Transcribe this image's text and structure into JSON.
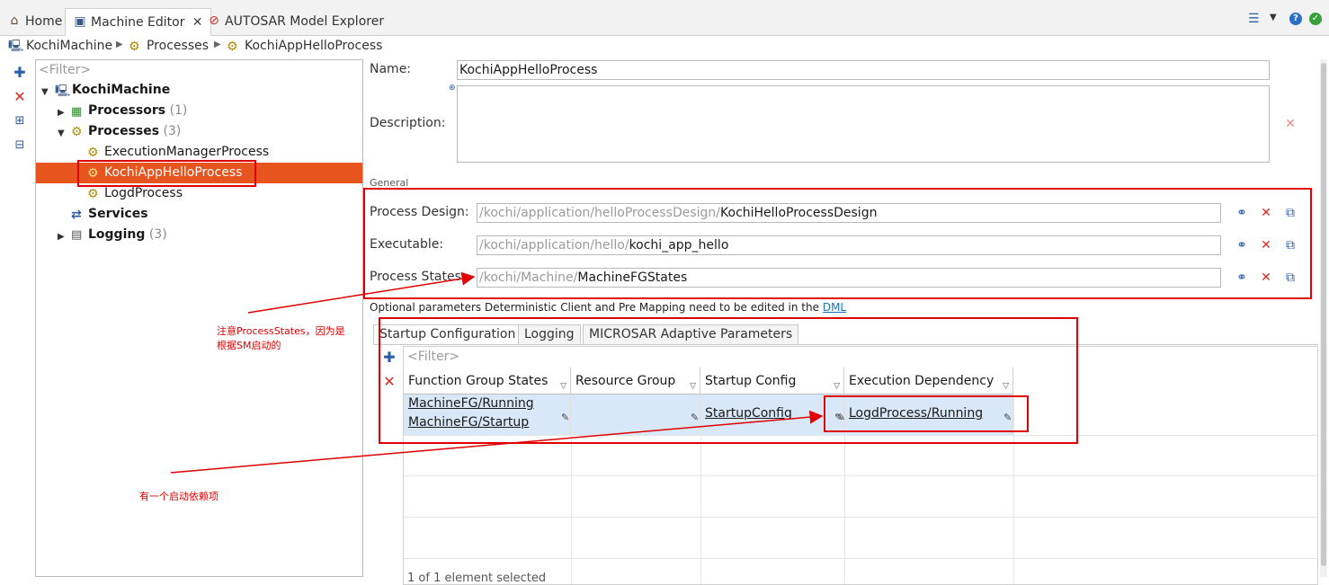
{
  "tabs": [
    {
      "label": "Home",
      "icon": "home-icon"
    },
    {
      "label": "Machine Editor",
      "icon": "machine-editor-icon",
      "close": "✕"
    },
    {
      "label": "AUTOSAR Model Explorer",
      "icon": "autosar-icon"
    }
  ],
  "breadcrumb": [
    "KochiMachine",
    "Processes",
    "KochiAppHelloProcess"
  ],
  "tree": {
    "filter_placeholder": "<Filter>",
    "root": "KochiMachine",
    "processors": {
      "label": "Processors",
      "count": "(1)"
    },
    "processes": {
      "label": "Processes",
      "count": "(3)"
    },
    "process_items": [
      "ExecutionManagerProcess",
      "KochiAppHelloProcess",
      "LogdProcess"
    ],
    "services": {
      "label": "Services"
    },
    "logging": {
      "label": "Logging",
      "count": "(3)"
    }
  },
  "form": {
    "name_label": "Name:",
    "name_value": "KochiAppHelloProcess",
    "description_label": "Description:",
    "general_label": "General",
    "process_design_label": "Process Design:",
    "process_design_prefix": "/kochi/application/helloProcessDesign/",
    "process_design_value": "KochiHelloProcessDesign",
    "executable_label": "Executable:",
    "executable_prefix": "/kochi/application/hello/",
    "executable_value": "kochi_app_hello",
    "process_states_label": "Process States",
    "process_states_prefix": "/kochi/Machine/",
    "process_states_value": "MachineFGStates",
    "optional_note": "Optional parameters Deterministic Client and Pre Mapping need to be edited in the",
    "dml_link": "DML"
  },
  "inner_tabs": [
    "Startup Configuration",
    "Logging",
    "MICROSAR Adaptive Parameters"
  ],
  "table": {
    "filter_placeholder": "<Filter>",
    "columns": [
      "Function Group States",
      "Resource Group",
      "Startup Config",
      "Execution Dependency"
    ],
    "rows": [
      {
        "function_group_states": [
          "MachineFG/Running",
          "MachineFG/Startup"
        ],
        "resource_group": "",
        "startup_config": "StartupConfig",
        "execution_dependency": "LogdProcess/Running"
      }
    ],
    "status": "1 of 1 element selected"
  },
  "annotations": {
    "note1_line1": "注意ProcessStates，因为是",
    "note1_line2": "根据SM启动的",
    "note2": "有一个启动依赖项"
  },
  "colors": {
    "selection": "#e8541e",
    "annotation_red": "#e00000",
    "row_highlight": "#d8e8f8"
  }
}
